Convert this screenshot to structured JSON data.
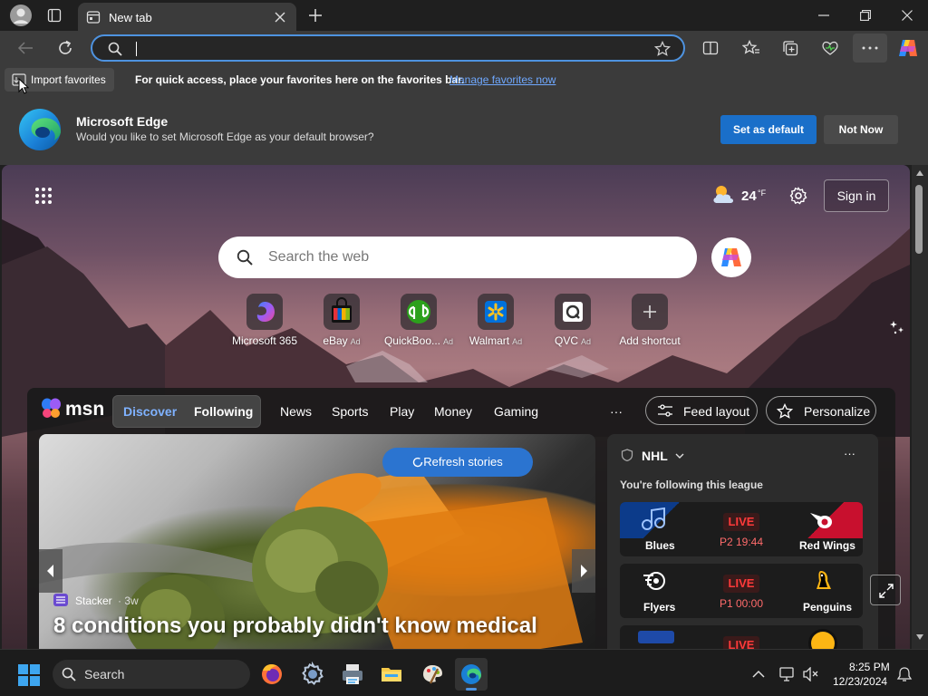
{
  "browser": {
    "tab_title": "New tab",
    "address_value": "",
    "accent": "#4e93e0"
  },
  "favorites_bar": {
    "import_label": "Import favorites",
    "message": "For quick access, place your favorites here on the favorites bar.",
    "manage_link": "Manage favorites now"
  },
  "default_banner": {
    "title": "Microsoft Edge",
    "message": "Would you like to set Microsoft Edge as your default browser?",
    "set_default": "Set as default",
    "not_now": "Not Now"
  },
  "newtab": {
    "weather_temp": "24",
    "weather_unit": "°F",
    "sign_in": "Sign in",
    "search_placeholder": "Search the web",
    "quick_links": [
      {
        "label": "Microsoft 365",
        "ad": ""
      },
      {
        "label": "eBay",
        "ad": "Ad"
      },
      {
        "label": "QuickBoo...",
        "ad": "Ad"
      },
      {
        "label": "Walmart",
        "ad": "Ad"
      },
      {
        "label": "QVC",
        "ad": "Ad"
      },
      {
        "label": "Add shortcut",
        "ad": ""
      }
    ]
  },
  "feed": {
    "logo": "msn",
    "tabs": [
      "Discover",
      "Following"
    ],
    "nav": [
      "News",
      "Sports",
      "Play",
      "Money",
      "Gaming"
    ],
    "more": "···",
    "feed_layout": "Feed layout",
    "personalize": "Personalize",
    "refresh": "Refresh stories",
    "hero": {
      "source": "Stacker",
      "age": "· 3w",
      "headline": "8 conditions you probably didn't know medical"
    },
    "nhl": {
      "title": "NHL",
      "subtitle": "You're following this league",
      "more": "···",
      "games": [
        {
          "home": "Blues",
          "away": "Red Wings",
          "status": "LIVE",
          "clock": "P2 19:44"
        },
        {
          "home": "Flyers",
          "away": "Penguins",
          "status": "LIVE",
          "clock": "P1 00:00"
        },
        {
          "home": "",
          "away": "",
          "status": "LIVE",
          "clock": ""
        }
      ]
    }
  },
  "taskbar": {
    "search": "Search",
    "time": "8:25 PM",
    "date": "12/23/2024"
  }
}
